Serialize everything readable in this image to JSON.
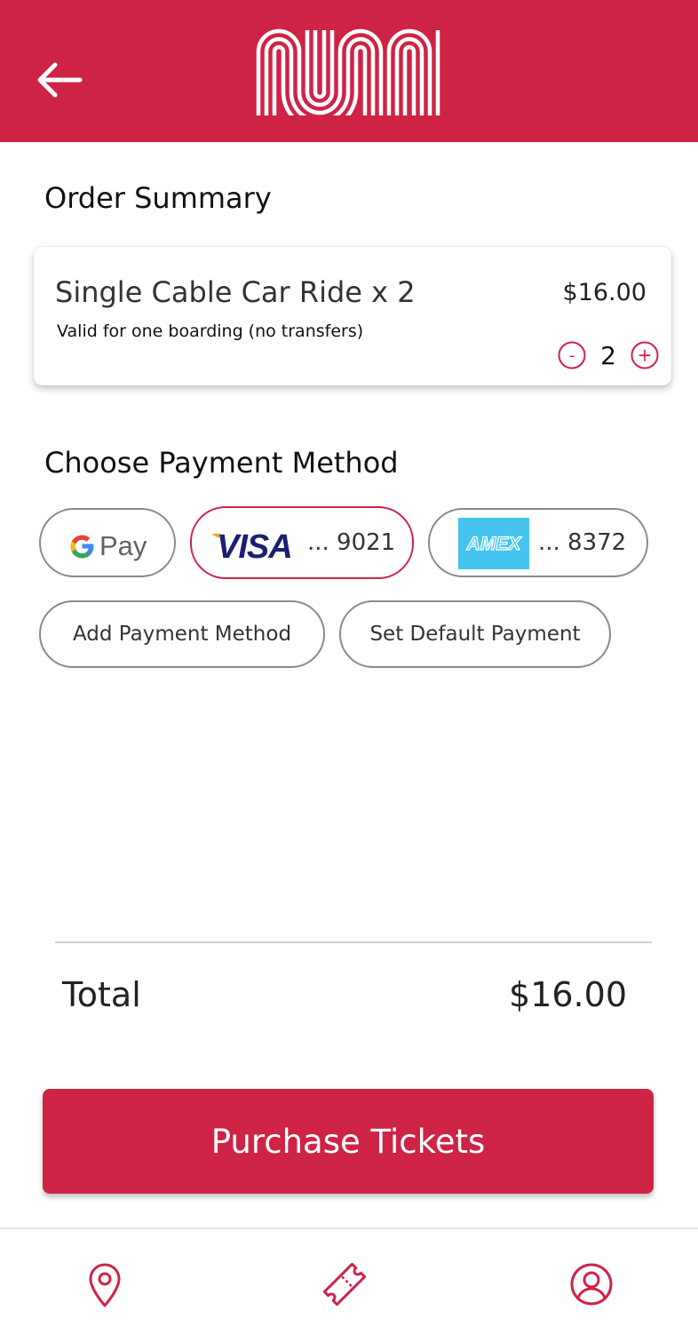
{
  "app": {
    "logo_text": "MUNI",
    "brand_color": "#cf2346"
  },
  "header": {
    "back_icon": "arrow-left-icon"
  },
  "order_summary": {
    "title": "Order Summary",
    "item": {
      "name": "Single Cable Car Ride x 2",
      "description": "Valid for one boarding (no transfers)",
      "price": "$16.00",
      "quantity": "2",
      "decrement_label": "-",
      "increment_label": "+"
    }
  },
  "payment": {
    "title": "Choose Payment Method",
    "methods": [
      {
        "id": "gpay",
        "brand": "G Pay",
        "label": "",
        "selected": false
      },
      {
        "id": "visa",
        "brand": "VISA",
        "label": "... 9021",
        "selected": true
      },
      {
        "id": "amex",
        "brand": "AMEX",
        "label": "... 8372",
        "selected": false
      }
    ],
    "add_label": "Add Payment Method",
    "default_label": "Set Default Payment"
  },
  "total": {
    "label": "Total",
    "value": "$16.00"
  },
  "purchase": {
    "label": "Purchase Tickets"
  },
  "bottom_nav": {
    "items": [
      {
        "icon": "map-pin-icon"
      },
      {
        "icon": "ticket-icon"
      },
      {
        "icon": "user-circle-icon"
      }
    ]
  }
}
